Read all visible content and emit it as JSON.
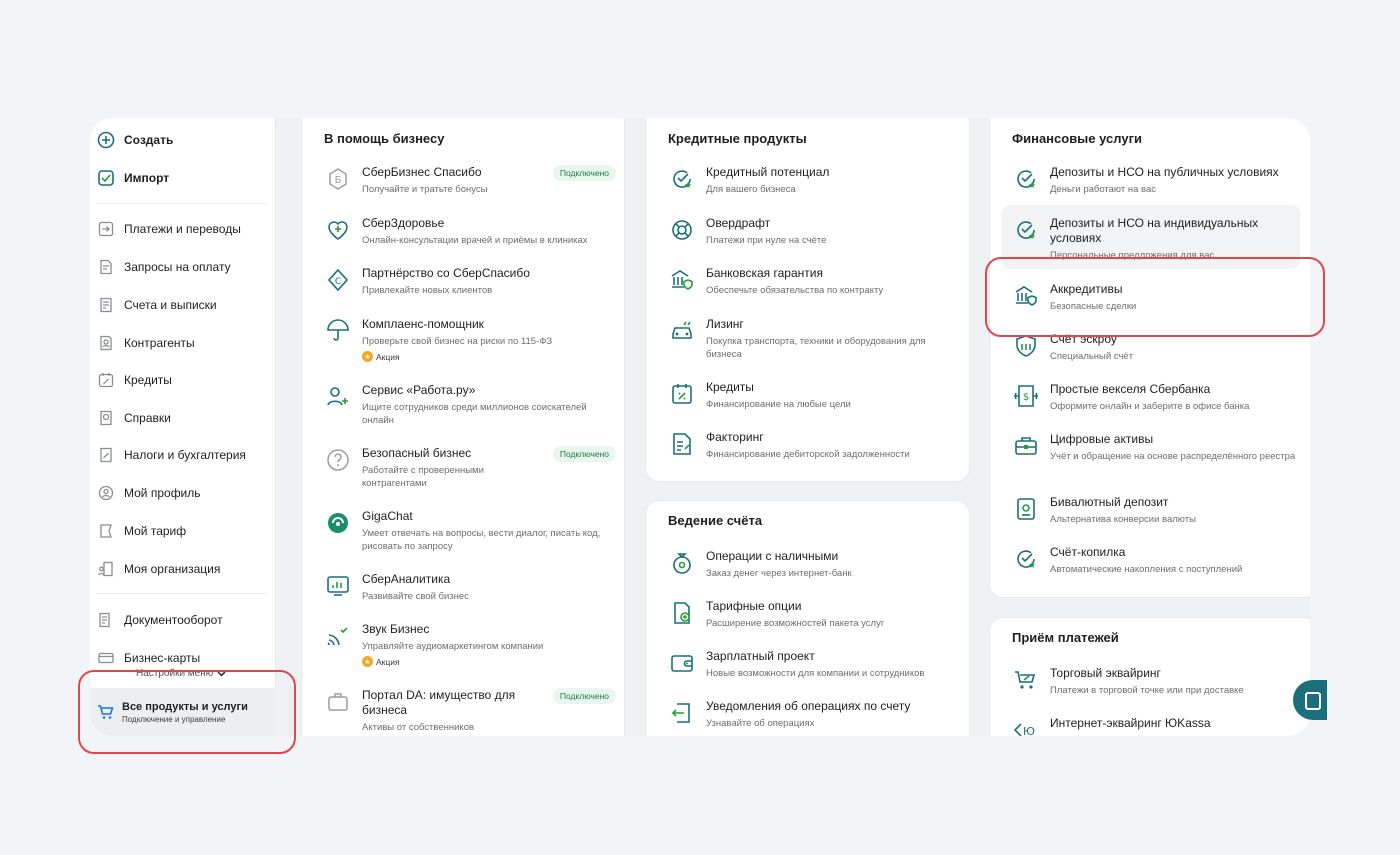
{
  "sidebar": {
    "create": "Создать",
    "import": "Импорт",
    "items": [
      {
        "label": "Платежи и переводы"
      },
      {
        "label": "Запросы на оплату"
      },
      {
        "label": "Счета и выписки"
      },
      {
        "label": "Контрагенты"
      },
      {
        "label": "Кредиты"
      },
      {
        "label": "Справки"
      },
      {
        "label": "Налоги и бухгалтерия"
      },
      {
        "label": "Мой профиль"
      },
      {
        "label": "Мой тариф"
      },
      {
        "label": "Моя организация"
      }
    ],
    "extra": [
      {
        "label": "Документооборот"
      },
      {
        "label": "Бизнес-карты"
      }
    ],
    "settings_label": "Настройки меню",
    "all_products_title": "Все продукты и услуги",
    "all_products_sub": "Подключение и управление"
  },
  "business": {
    "title": "В помощь бизнесу",
    "items": [
      {
        "name": "СберБизнес Спасибо",
        "desc": "Получайте и тратьте бонусы",
        "badge": "Подключено"
      },
      {
        "name": "СберЗдоровье",
        "desc": "Онлайн-консультации врачей и приёмы в клиниках"
      },
      {
        "name": "Партнёрство со СберСпасибо",
        "desc": "Привлекайте новых клиентов"
      },
      {
        "name": "Комплаенс-помощник",
        "desc": "Проверьте свой бизнес на риски по 115-ФЗ",
        "promo": "Акция"
      },
      {
        "name": "Сервис «Работа.ру»",
        "desc": "Ищите сотрудников среди миллионов соискателей онлайн"
      },
      {
        "name": "Безопасный бизнес",
        "desc": "Работайте с проверенными контрагентами",
        "badge": "Подключено"
      },
      {
        "name": "GigaChat",
        "desc": "Умеет отвечать на вопросы, вести диалог, писать код, рисовать по запросу"
      },
      {
        "name": "СберАналитика",
        "desc": "Развивайте свой бизнес"
      },
      {
        "name": "Звук Бизнес",
        "desc": "Управляйте аудиомаркетингом компании",
        "promo": "Акция"
      },
      {
        "name": "Портал DA: имущество для бизнеса",
        "desc": "Активы от собственников",
        "badge": "Подключено"
      }
    ]
  },
  "credit": {
    "title": "Кредитные продукты",
    "items": [
      {
        "name": "Кредитный потенциал",
        "desc": "Для вашего бизнеса"
      },
      {
        "name": "Овердрафт",
        "desc": "Платежи при нуле на счёте"
      },
      {
        "name": "Банковская гарантия",
        "desc": "Обеспечьте обязательства по контракту"
      },
      {
        "name": "Лизинг",
        "desc": "Покупка транспорта, техники и оборудования для бизнеса"
      },
      {
        "name": "Кредиты",
        "desc": "Финансирование на любые цели"
      },
      {
        "name": "Факторинг",
        "desc": "Финансирование дебиторской задолженности"
      }
    ]
  },
  "account": {
    "title": "Ведение счёта",
    "items": [
      {
        "name": "Операции с наличными",
        "desc": "Заказ денег через интернет-банк"
      },
      {
        "name": "Тарифные опции",
        "desc": "Расширение возможностей пакета услуг"
      },
      {
        "name": "Зарплатный проект",
        "desc": "Новые возможности для компании и сотрудников"
      },
      {
        "name": "Уведомления об операциях по счету",
        "desc": "Узнавайте об операциях"
      }
    ]
  },
  "finance": {
    "title": "Финансовые услуги",
    "items": [
      {
        "name": "Депозиты и НСО на публичных условиях",
        "desc": "Деньги работают на вас"
      },
      {
        "name": "Депозиты и НСО на индивидуальных условиях",
        "desc": "Персональные предложения для вас"
      },
      {
        "name": "Аккредитивы",
        "desc": "Безопасные сделки"
      },
      {
        "name": "Счёт эскроу",
        "desc": "Специальный счёт"
      },
      {
        "name": "Простые векселя Сбербанка",
        "desc": "Оформите онлайн и заберите в офисе банка"
      },
      {
        "name": "Цифровые активы",
        "desc": "Учёт и обращение на основе распределённого реестра"
      },
      {
        "name": "Бивалютный депозит",
        "desc": "Альтернатива конверсии валюты"
      },
      {
        "name": "Счёт-копилка",
        "desc": "Автоматические накопления с поступлений"
      }
    ]
  },
  "payments": {
    "title": "Приём платежей",
    "items": [
      {
        "name": "Торговый эквайринг",
        "desc": "Платежи в торговой точке или при доставке"
      },
      {
        "name": "Интернет-эквайринг ЮKassa",
        "desc": ""
      }
    ]
  },
  "colors": {
    "accent": "#1b6f7a",
    "green": "#21a038",
    "highlight": "#e0464c"
  }
}
